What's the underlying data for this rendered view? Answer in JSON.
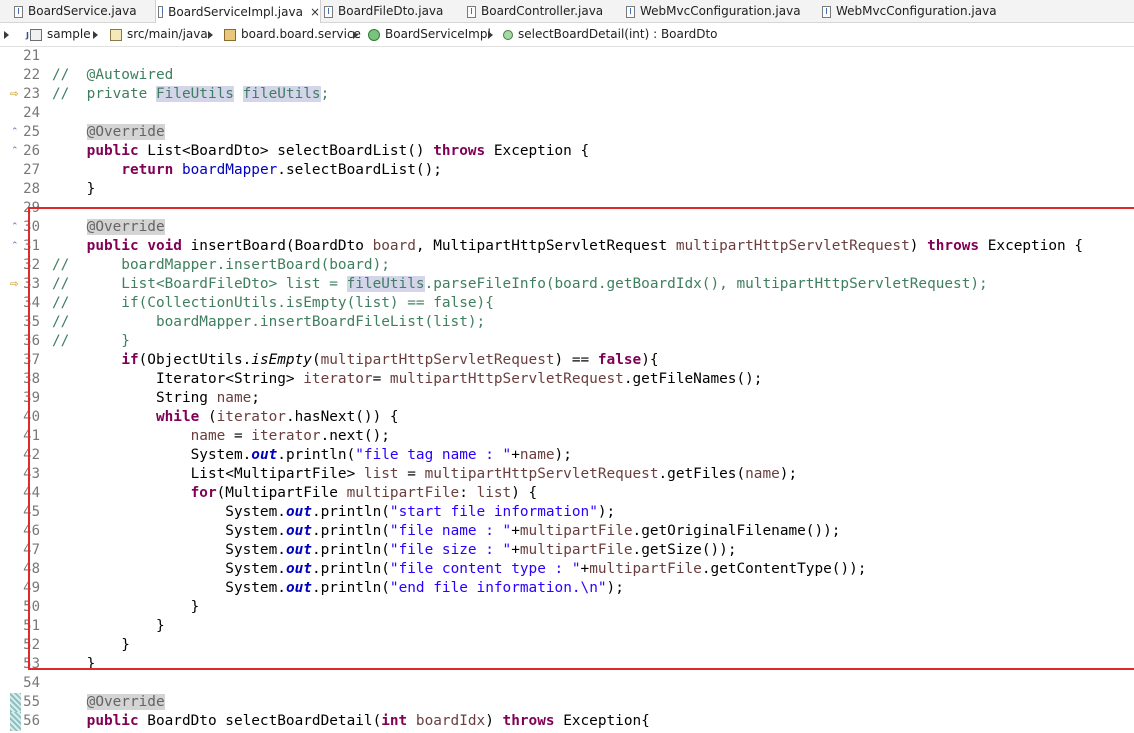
{
  "tabs": [
    {
      "label": "BoardService.java",
      "active": false
    },
    {
      "label": "BoardServiceImpl.java",
      "active": true,
      "close": "×"
    },
    {
      "label": "BoardFileDto.java",
      "active": false
    },
    {
      "label": "BoardController.java",
      "active": false
    },
    {
      "label": "WebMvcConfiguration.java",
      "active": false
    },
    {
      "label": "WebMvcConfiguration.java",
      "active": false
    }
  ],
  "breadcrumb": [
    "sample",
    "src/main/java",
    "board.board.service",
    "BoardServiceImpl",
    "selectBoardDetail(int) : BoardDto"
  ],
  "gutter": {
    "fold_icon": "⌃",
    "marker_icon": "⇨"
  },
  "lines": [
    {
      "n": "21",
      "t": []
    },
    {
      "n": "22",
      "t": [
        {
          "c": "cm",
          "s": "//  @Autowired"
        }
      ]
    },
    {
      "n": "23",
      "t": [
        {
          "c": "cm",
          "s": "//  private "
        },
        {
          "c": "cm occ",
          "s": "FileUtils"
        },
        {
          "c": "cm",
          "s": " "
        },
        {
          "c": "cm occ",
          "s": "fileUtils"
        },
        {
          "c": "cm",
          "s": ";"
        }
      ]
    },
    {
      "n": "24",
      "t": []
    },
    {
      "n": "25",
      "t": [
        {
          "c": "",
          "s": "    "
        },
        {
          "c": "an-hl",
          "s": "@Override"
        }
      ]
    },
    {
      "n": "26",
      "t": [
        {
          "c": "",
          "s": "    "
        },
        {
          "c": "kw",
          "s": "public"
        },
        {
          "c": "",
          "s": " List<BoardDto> selectBoardList() "
        },
        {
          "c": "kw",
          "s": "throws"
        },
        {
          "c": "",
          "s": " Exception {"
        }
      ]
    },
    {
      "n": "27",
      "t": [
        {
          "c": "",
          "s": "        "
        },
        {
          "c": "kw",
          "s": "return"
        },
        {
          "c": "",
          "s": " "
        },
        {
          "c": "fld",
          "s": "boardMapper"
        },
        {
          "c": "",
          "s": ".selectBoardList();"
        }
      ]
    },
    {
      "n": "28",
      "t": [
        {
          "c": "",
          "s": "    }"
        }
      ]
    },
    {
      "n": "29",
      "t": []
    },
    {
      "n": "30",
      "t": [
        {
          "c": "",
          "s": "    "
        },
        {
          "c": "an-hl",
          "s": "@Override"
        }
      ]
    },
    {
      "n": "31",
      "t": [
        {
          "c": "",
          "s": "    "
        },
        {
          "c": "kw",
          "s": "public"
        },
        {
          "c": "",
          "s": " "
        },
        {
          "c": "kw",
          "s": "void"
        },
        {
          "c": "",
          "s": " insertBoard(BoardDto "
        },
        {
          "c": "var",
          "s": "board"
        },
        {
          "c": "",
          "s": ", MultipartHttpServletRequest "
        },
        {
          "c": "var",
          "s": "multipartHttpServletRequest"
        },
        {
          "c": "",
          "s": ") "
        },
        {
          "c": "kw",
          "s": "throws"
        },
        {
          "c": "",
          "s": " Exception {"
        }
      ]
    },
    {
      "n": "32",
      "t": [
        {
          "c": "cm",
          "s": "//      boardMapper.insertBoard(board);"
        }
      ]
    },
    {
      "n": "33",
      "t": [
        {
          "c": "cm",
          "s": "//      List<BoardFileDto> list = "
        },
        {
          "c": "cm occ",
          "s": "fileUtils"
        },
        {
          "c": "cm",
          "s": ".parseFileInfo(board.getBoardIdx(), multipartHttpServletRequest);"
        }
      ]
    },
    {
      "n": "34",
      "t": [
        {
          "c": "cm",
          "s": "//      if(CollectionUtils.isEmpty(list) == false){"
        }
      ]
    },
    {
      "n": "35",
      "t": [
        {
          "c": "cm",
          "s": "//          boardMapper.insertBoardFileList(list);"
        }
      ]
    },
    {
      "n": "36",
      "t": [
        {
          "c": "cm",
          "s": "//      }"
        }
      ]
    },
    {
      "n": "37",
      "t": [
        {
          "c": "",
          "s": "        "
        },
        {
          "c": "kw",
          "s": "if"
        },
        {
          "c": "",
          "s": "(ObjectUtils."
        },
        {
          "c": "sm",
          "s": "isEmpty"
        },
        {
          "c": "",
          "s": "("
        },
        {
          "c": "var",
          "s": "multipartHttpServletRequest"
        },
        {
          "c": "",
          "s": ") == "
        },
        {
          "c": "kw",
          "s": "false"
        },
        {
          "c": "",
          "s": "){"
        }
      ]
    },
    {
      "n": "38",
      "t": [
        {
          "c": "",
          "s": "            Iterator<String> "
        },
        {
          "c": "var",
          "s": "iterator"
        },
        {
          "c": "",
          "s": "= "
        },
        {
          "c": "var",
          "s": "multipartHttpServletRequest"
        },
        {
          "c": "",
          "s": ".getFileNames();"
        }
      ]
    },
    {
      "n": "39",
      "t": [
        {
          "c": "",
          "s": "            String "
        },
        {
          "c": "var",
          "s": "name"
        },
        {
          "c": "",
          "s": ";"
        }
      ]
    },
    {
      "n": "40",
      "t": [
        {
          "c": "",
          "s": "            "
        },
        {
          "c": "kw",
          "s": "while"
        },
        {
          "c": "",
          "s": " ("
        },
        {
          "c": "var",
          "s": "iterator"
        },
        {
          "c": "",
          "s": ".hasNext()) {"
        }
      ]
    },
    {
      "n": "41",
      "t": [
        {
          "c": "",
          "s": "                "
        },
        {
          "c": "var",
          "s": "name"
        },
        {
          "c": "",
          "s": " = "
        },
        {
          "c": "var",
          "s": "iterator"
        },
        {
          "c": "",
          "s": ".next();"
        }
      ]
    },
    {
      "n": "42",
      "t": [
        {
          "c": "",
          "s": "                System."
        },
        {
          "c": "sfld",
          "s": "out"
        },
        {
          "c": "",
          "s": ".println("
        },
        {
          "c": "str",
          "s": "\"file tag name : \""
        },
        {
          "c": "",
          "s": "+"
        },
        {
          "c": "var",
          "s": "name"
        },
        {
          "c": "",
          "s": ");"
        }
      ]
    },
    {
      "n": "43",
      "t": [
        {
          "c": "",
          "s": "                List<MultipartFile> "
        },
        {
          "c": "var",
          "s": "list"
        },
        {
          "c": "",
          "s": " = "
        },
        {
          "c": "var",
          "s": "multipartHttpServletRequest"
        },
        {
          "c": "",
          "s": ".getFiles("
        },
        {
          "c": "var",
          "s": "name"
        },
        {
          "c": "",
          "s": ");"
        }
      ]
    },
    {
      "n": "44",
      "t": [
        {
          "c": "",
          "s": "                "
        },
        {
          "c": "kw",
          "s": "for"
        },
        {
          "c": "",
          "s": "(MultipartFile "
        },
        {
          "c": "var",
          "s": "multipartFile"
        },
        {
          "c": "",
          "s": ": "
        },
        {
          "c": "var",
          "s": "list"
        },
        {
          "c": "",
          "s": ") {"
        }
      ]
    },
    {
      "n": "45",
      "t": [
        {
          "c": "",
          "s": "                    System."
        },
        {
          "c": "sfld",
          "s": "out"
        },
        {
          "c": "",
          "s": ".println("
        },
        {
          "c": "str",
          "s": "\"start file information\""
        },
        {
          "c": "",
          "s": ");"
        }
      ]
    },
    {
      "n": "46",
      "t": [
        {
          "c": "",
          "s": "                    System."
        },
        {
          "c": "sfld",
          "s": "out"
        },
        {
          "c": "",
          "s": ".println("
        },
        {
          "c": "str",
          "s": "\"file name : \""
        },
        {
          "c": "",
          "s": "+"
        },
        {
          "c": "var",
          "s": "multipartFile"
        },
        {
          "c": "",
          "s": ".getOriginalFilename());"
        }
      ]
    },
    {
      "n": "47",
      "t": [
        {
          "c": "",
          "s": "                    System."
        },
        {
          "c": "sfld",
          "s": "out"
        },
        {
          "c": "",
          "s": ".println("
        },
        {
          "c": "str",
          "s": "\"file size : \""
        },
        {
          "c": "",
          "s": "+"
        },
        {
          "c": "var",
          "s": "multipartFile"
        },
        {
          "c": "",
          "s": ".getSize());"
        }
      ]
    },
    {
      "n": "48",
      "t": [
        {
          "c": "",
          "s": "                    System."
        },
        {
          "c": "sfld",
          "s": "out"
        },
        {
          "c": "",
          "s": ".println("
        },
        {
          "c": "str",
          "s": "\"file content type : \""
        },
        {
          "c": "",
          "s": "+"
        },
        {
          "c": "var",
          "s": "multipartFile"
        },
        {
          "c": "",
          "s": ".getContentType());"
        }
      ]
    },
    {
      "n": "49",
      "t": [
        {
          "c": "",
          "s": "                    System."
        },
        {
          "c": "sfld",
          "s": "out"
        },
        {
          "c": "",
          "s": ".println("
        },
        {
          "c": "str",
          "s": "\"end file information.\\n\""
        },
        {
          "c": "",
          "s": ");"
        }
      ]
    },
    {
      "n": "50",
      "t": [
        {
          "c": "",
          "s": "                }"
        }
      ]
    },
    {
      "n": "51",
      "t": [
        {
          "c": "",
          "s": "            }"
        }
      ]
    },
    {
      "n": "52",
      "t": [
        {
          "c": "",
          "s": "        }"
        }
      ]
    },
    {
      "n": "53",
      "t": [
        {
          "c": "",
          "s": "    }"
        }
      ]
    },
    {
      "n": "54",
      "t": []
    },
    {
      "n": "55",
      "t": [
        {
          "c": "",
          "s": "    "
        },
        {
          "c": "an-hl",
          "s": "@Override"
        }
      ]
    },
    {
      "n": "56",
      "t": [
        {
          "c": "",
          "s": "    "
        },
        {
          "c": "kw",
          "s": "public"
        },
        {
          "c": "",
          "s": " BoardDto selectBoardDetail("
        },
        {
          "c": "kw",
          "s": "int"
        },
        {
          "c": "",
          "s": " "
        },
        {
          "c": "var",
          "s": "boardIdx"
        },
        {
          "c": "",
          "s": ") "
        },
        {
          "c": "kw",
          "s": "throws"
        },
        {
          "c": "",
          "s": " Exception{"
        }
      ]
    }
  ]
}
